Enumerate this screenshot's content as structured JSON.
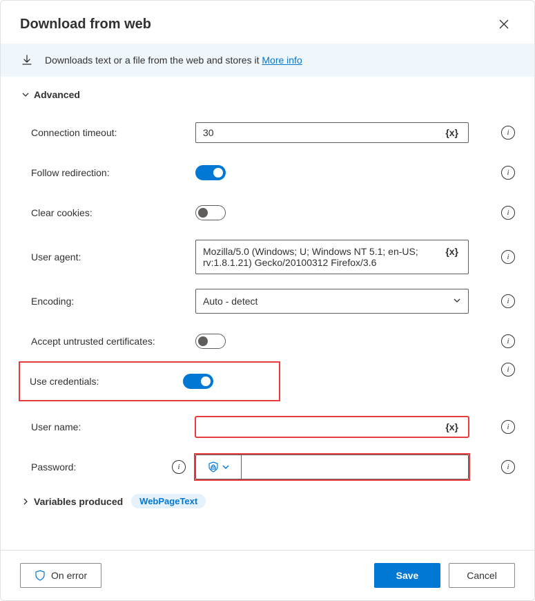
{
  "dialog": {
    "title": "Download from web"
  },
  "banner": {
    "text": "Downloads text or a file from the web and stores it ",
    "more_info": "More info"
  },
  "sections": {
    "advanced": "Advanced",
    "variables_produced": "Variables produced"
  },
  "fields": {
    "connection_timeout": {
      "label": "Connection timeout:",
      "value": "30",
      "var_token": "{x}"
    },
    "follow_redirection": {
      "label": "Follow redirection:"
    },
    "clear_cookies": {
      "label": "Clear cookies:"
    },
    "user_agent": {
      "label": "User agent:",
      "value": "Mozilla/5.0 (Windows; U; Windows NT 5.1; en-US; rv:1.8.1.21) Gecko/20100312 Firefox/3.6",
      "var_token": "{x}"
    },
    "encoding": {
      "label": "Encoding:",
      "value": "Auto - detect"
    },
    "accept_untrusted": {
      "label": "Accept untrusted certificates:"
    },
    "use_credentials": {
      "label": "Use credentials:"
    },
    "user_name": {
      "label": "User name:",
      "value": "",
      "var_token": "{x}"
    },
    "password": {
      "label": "Password:",
      "value": ""
    }
  },
  "variables": {
    "chip": "WebPageText"
  },
  "footer": {
    "on_error": "On error",
    "save": "Save",
    "cancel": "Cancel"
  }
}
